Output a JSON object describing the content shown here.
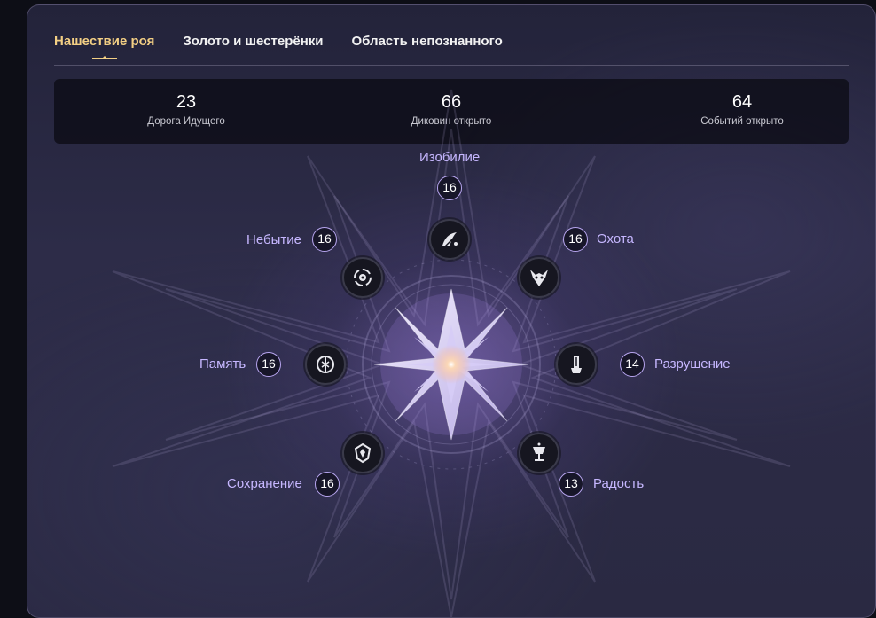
{
  "tabs": [
    {
      "label": "Нашествие роя",
      "active": true
    },
    {
      "label": "Золото и шестерёнки",
      "active": false
    },
    {
      "label": "Область непознанного",
      "active": false
    }
  ],
  "stats": [
    {
      "value": "23",
      "label": "Дорога Идущего"
    },
    {
      "value": "66",
      "label": "Диковин открыто"
    },
    {
      "value": "64",
      "label": "Событий открыто"
    }
  ],
  "paths": [
    {
      "name": "Изобилие",
      "count": "16",
      "icon": "abundance-icon"
    },
    {
      "name": "Охота",
      "count": "16",
      "icon": "hunt-icon"
    },
    {
      "name": "Разрушение",
      "count": "14",
      "icon": "destruction-icon"
    },
    {
      "name": "Радость",
      "count": "13",
      "icon": "elation-icon"
    },
    {
      "name": "Сохранение",
      "count": "16",
      "icon": "preservation-icon"
    },
    {
      "name": "Память",
      "count": "16",
      "icon": "remembrance-icon"
    },
    {
      "name": "Небытие",
      "count": "16",
      "icon": "nihility-icon"
    }
  ],
  "colors": {
    "accent": "#f3cf84",
    "path_label": "#c6b7ff",
    "badge_border": "#b8a6f0"
  }
}
